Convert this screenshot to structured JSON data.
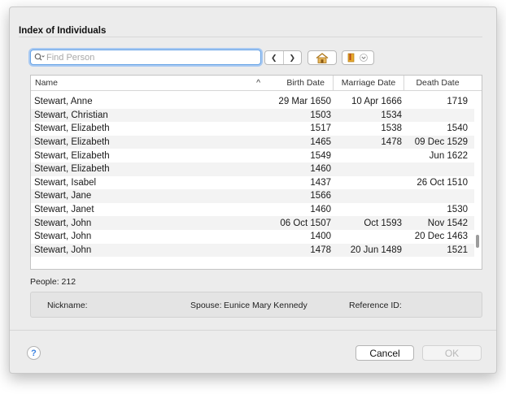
{
  "dialog": {
    "title": "Index of Individuals"
  },
  "toolbar": {
    "search_placeholder": "Find Person",
    "search_value": "",
    "back_glyph": "❮",
    "forward_glyph": "❯"
  },
  "table": {
    "columns": {
      "name": "Name",
      "birth": "Birth Date",
      "marriage": "Marriage Date",
      "death": "Death Date"
    },
    "sort_indicator": "^",
    "rows": [
      {
        "name": "Stewart, Anne",
        "birth": "29 Mar 1650",
        "marriage": "10 Apr 1666",
        "death": "1719"
      },
      {
        "name": "Stewart, Christian",
        "birth": "1503",
        "marriage": "1534",
        "death": ""
      },
      {
        "name": "Stewart, Elizabeth",
        "birth": "1517",
        "marriage": "1538",
        "death": "1540"
      },
      {
        "name": "Stewart, Elizabeth",
        "birth": "1465",
        "marriage": "1478",
        "death": "09 Dec 1529"
      },
      {
        "name": "Stewart, Elizabeth",
        "birth": "1549",
        "marriage": "",
        "death": "Jun 1622"
      },
      {
        "name": "Stewart, Elizabeth",
        "birth": "1460",
        "marriage": "",
        "death": ""
      },
      {
        "name": "Stewart, Isabel",
        "birth": "1437",
        "marriage": "",
        "death": "26 Oct 1510"
      },
      {
        "name": "Stewart, Jane",
        "birth": "1566",
        "marriage": "",
        "death": ""
      },
      {
        "name": "Stewart, Janet",
        "birth": "1460",
        "marriage": "",
        "death": "1530"
      },
      {
        "name": "Stewart, John",
        "birth": "06 Oct 1507",
        "marriage": "Oct 1593",
        "death": "Nov 1542"
      },
      {
        "name": "Stewart, John",
        "birth": "1400",
        "marriage": "",
        "death": "20 Dec 1463"
      },
      {
        "name": "Stewart, John",
        "birth": "1478",
        "marriage": "20 Jun 1489",
        "death": "1521"
      }
    ]
  },
  "status": {
    "people_label": "People:",
    "people_count": "212"
  },
  "details": {
    "nickname_label": "Nickname:",
    "spouse_label": "Spouse:",
    "spouse_value": "Eunice Mary Kennedy",
    "reference_label": "Reference ID:"
  },
  "footer": {
    "help_glyph": "?",
    "cancel_label": "Cancel",
    "ok_label": "OK"
  },
  "colors": {
    "focus_ring": "#6aa5e6",
    "help_blue": "#3b82e0",
    "home_icon": "#d9a23a",
    "bookmark_icon": "#e2a32a"
  }
}
